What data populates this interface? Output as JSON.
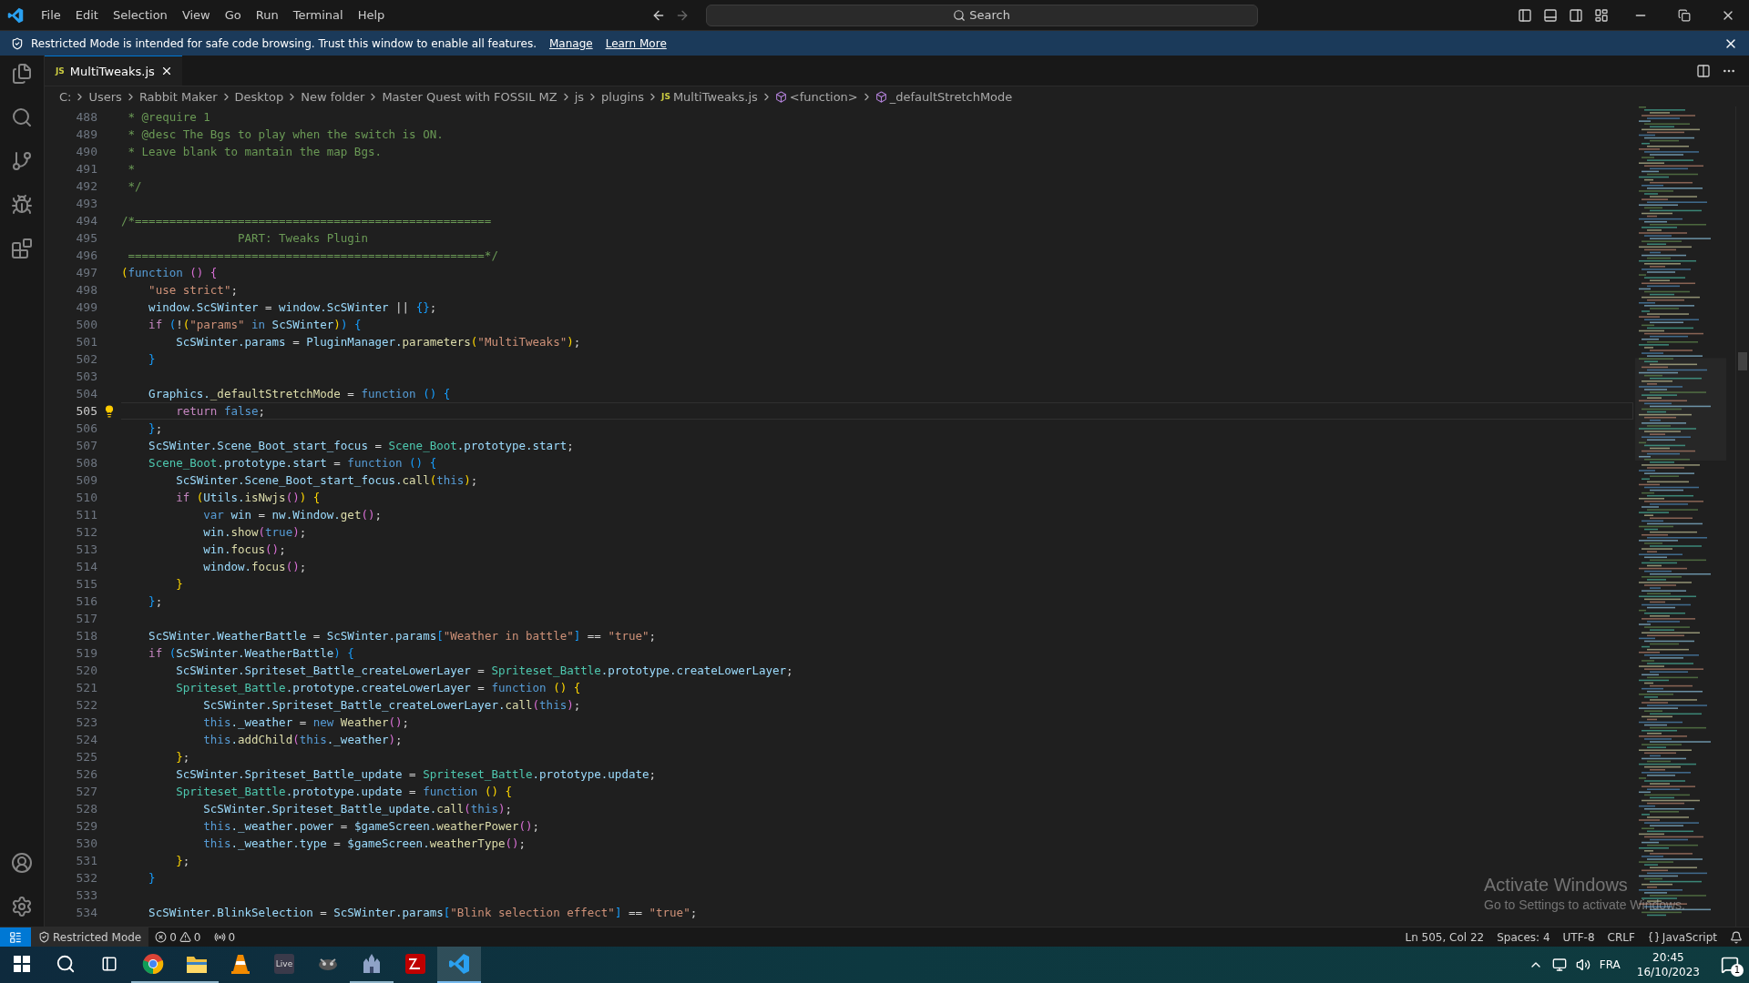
{
  "title_bar": {
    "menu": [
      "File",
      "Edit",
      "Selection",
      "View",
      "Go",
      "Run",
      "Terminal",
      "Help"
    ],
    "search": {
      "placeholder": "Search"
    }
  },
  "banner": {
    "message": "Restricted Mode is intended for safe code browsing. Trust this window to enable all features.",
    "links": [
      "Manage",
      "Learn More"
    ]
  },
  "tabs": [
    {
      "label": "MultiTweaks.js",
      "badge": "JS",
      "selected": true
    }
  ],
  "breadcrumbs": [
    {
      "label": "C:",
      "kind": "folder"
    },
    {
      "label": "Users",
      "kind": "folder"
    },
    {
      "label": "Rabbit Maker",
      "kind": "folder"
    },
    {
      "label": "Desktop",
      "kind": "folder"
    },
    {
      "label": "New folder",
      "kind": "folder"
    },
    {
      "label": "Master Quest with FOSSIL MZ",
      "kind": "folder"
    },
    {
      "label": "js",
      "kind": "folder"
    },
    {
      "label": "plugins",
      "kind": "folder"
    },
    {
      "label": "MultiTweaks.js",
      "kind": "file",
      "badge": "JS"
    },
    {
      "label": "<function>",
      "kind": "symbol"
    },
    {
      "label": "_defaultStretchMode",
      "kind": "symbol"
    }
  ],
  "editor": {
    "lines": [
      {
        "number": "488",
        "current": false,
        "tokens": [
          {
            "kind": "comment",
            "text": " * @require 1"
          }
        ]
      },
      {
        "number": "489",
        "current": false,
        "tokens": [
          {
            "kind": "comment",
            "text": " * @desc The Bgs to play when the switch is ON."
          }
        ]
      },
      {
        "number": "490",
        "current": false,
        "tokens": [
          {
            "kind": "comment",
            "text": " * Leave blank to mantain the map Bgs."
          }
        ]
      },
      {
        "number": "491",
        "current": false,
        "tokens": [
          {
            "kind": "comment",
            "text": " *"
          }
        ]
      },
      {
        "number": "492",
        "current": false,
        "tokens": [
          {
            "kind": "comment",
            "text": " */"
          }
        ]
      },
      {
        "number": "493",
        "current": false
      },
      {
        "number": "494",
        "current": false,
        "tokens": [
          {
            "kind": "comment",
            "text": "/*===================================================="
          }
        ]
      },
      {
        "number": "495",
        "current": false,
        "tokens": [
          {
            "kind": "comment",
            "text": "                 PART: Tweaks Plugin"
          }
        ]
      },
      {
        "number": "496",
        "current": false,
        "tokens": [
          {
            "kind": "comment",
            "text": " ====================================================*/"
          }
        ]
      },
      {
        "number": "497",
        "current": false,
        "tokens": [
          {
            "kind": "bracket1",
            "text": "("
          },
          {
            "kind": "keyword",
            "text": "function "
          },
          {
            "kind": "bracket2",
            "text": "() {"
          }
        ]
      },
      {
        "number": "498",
        "current": false,
        "tokens": [
          {
            "kind": "string",
            "text": "    \"use strict\""
          },
          {
            "kind": "plain",
            "text": ";"
          }
        ]
      },
      {
        "number": "499",
        "current": false,
        "tokens": [
          {
            "kind": "variable",
            "text": "    window.ScSWinter"
          },
          {
            "kind": "plain",
            "text": " = "
          },
          {
            "kind": "variable",
            "text": "window.ScSWinter"
          },
          {
            "kind": "plain",
            "text": " || "
          },
          {
            "kind": "bracket3",
            "text": "{}"
          },
          {
            "kind": "plain",
            "text": ";"
          }
        ]
      },
      {
        "number": "500",
        "current": false,
        "tokens": [
          {
            "kind": "control",
            "text": "    if "
          },
          {
            "kind": "bracket3",
            "text": "("
          },
          {
            "kind": "plain",
            "text": "!"
          },
          {
            "kind": "bracket1",
            "text": "("
          },
          {
            "kind": "string",
            "text": "\"params\" "
          },
          {
            "kind": "keyword",
            "text": "in"
          },
          {
            "kind": "variable",
            "text": " ScSWinter"
          },
          {
            "kind": "bracket1",
            "text": ")"
          },
          {
            "kind": "bracket3",
            "text": ") {"
          }
        ]
      },
      {
        "number": "501",
        "current": false,
        "tokens": [
          {
            "kind": "variable",
            "text": "        ScSWinter.params"
          },
          {
            "kind": "plain",
            "text": " = "
          },
          {
            "kind": "variable",
            "text": "PluginManager."
          },
          {
            "kind": "function",
            "text": "parameters"
          },
          {
            "kind": "bracket1",
            "text": "("
          },
          {
            "kind": "string",
            "text": "\"MultiTweaks\""
          },
          {
            "kind": "bracket1",
            "text": ")"
          },
          {
            "kind": "plain",
            "text": ";"
          }
        ]
      },
      {
        "number": "502",
        "current": false,
        "tokens": [
          {
            "kind": "bracket3",
            "text": "    }"
          }
        ]
      },
      {
        "number": "503",
        "current": false
      },
      {
        "number": "504",
        "current": false,
        "tokens": [
          {
            "kind": "variable",
            "text": "    Graphics."
          },
          {
            "kind": "function",
            "text": "_defaultStretchMode"
          },
          {
            "kind": "plain",
            "text": " = "
          },
          {
            "kind": "keyword",
            "text": "function "
          },
          {
            "kind": "bracket3",
            "text": "() {"
          }
        ]
      },
      {
        "number": "505",
        "current": true,
        "tokens": [
          {
            "kind": "control",
            "text": "        return "
          },
          {
            "kind": "keyword",
            "text": "false"
          },
          {
            "kind": "plain",
            "text": ";"
          }
        ]
      },
      {
        "number": "506",
        "current": false,
        "tokens": [
          {
            "kind": "bracket3",
            "text": "    }"
          },
          {
            "kind": "plain",
            "text": ";"
          }
        ]
      },
      {
        "number": "507",
        "current": false,
        "tokens": [
          {
            "kind": "variable",
            "text": "    ScSWinter.Scene_Boot_start_focus"
          },
          {
            "kind": "plain",
            "text": " = "
          },
          {
            "kind": "class",
            "text": "Scene_Boot"
          },
          {
            "kind": "variable",
            "text": ".prototype.start"
          },
          {
            "kind": "plain",
            "text": ";"
          }
        ]
      },
      {
        "number": "508",
        "current": false,
        "tokens": [
          {
            "kind": "class",
            "text": "    Scene_Boot"
          },
          {
            "kind": "variable",
            "text": ".prototype.start"
          },
          {
            "kind": "plain",
            "text": " = "
          },
          {
            "kind": "keyword",
            "text": "function "
          },
          {
            "kind": "bracket3",
            "text": "() {"
          }
        ]
      },
      {
        "number": "509",
        "current": false,
        "tokens": [
          {
            "kind": "variable",
            "text": "        ScSWinter.Scene_Boot_start_focus."
          },
          {
            "kind": "function",
            "text": "call"
          },
          {
            "kind": "bracket1",
            "text": "("
          },
          {
            "kind": "keyword",
            "text": "this"
          },
          {
            "kind": "bracket1",
            "text": ")"
          },
          {
            "kind": "plain",
            "text": ";"
          }
        ]
      },
      {
        "number": "510",
        "current": false,
        "tokens": [
          {
            "kind": "control",
            "text": "        if "
          },
          {
            "kind": "bracket1",
            "text": "("
          },
          {
            "kind": "variable",
            "text": "Utils."
          },
          {
            "kind": "function",
            "text": "isNwjs"
          },
          {
            "kind": "bracket2",
            "text": "()"
          },
          {
            "kind": "bracket1",
            "text": ") {"
          }
        ]
      },
      {
        "number": "511",
        "current": false,
        "tokens": [
          {
            "kind": "keyword",
            "text": "            var"
          },
          {
            "kind": "variable",
            "text": " win"
          },
          {
            "kind": "plain",
            "text": " = "
          },
          {
            "kind": "variable",
            "text": "nw.Window."
          },
          {
            "kind": "function",
            "text": "get"
          },
          {
            "kind": "bracket2",
            "text": "()"
          },
          {
            "kind": "plain",
            "text": ";"
          }
        ]
      },
      {
        "number": "512",
        "current": false,
        "tokens": [
          {
            "kind": "variable",
            "text": "            win."
          },
          {
            "kind": "function",
            "text": "show"
          },
          {
            "kind": "bracket2",
            "text": "("
          },
          {
            "kind": "keyword",
            "text": "true"
          },
          {
            "kind": "bracket2",
            "text": ")"
          },
          {
            "kind": "plain",
            "text": ";"
          }
        ]
      },
      {
        "number": "513",
        "current": false,
        "tokens": [
          {
            "kind": "variable",
            "text": "            win."
          },
          {
            "kind": "function",
            "text": "focus"
          },
          {
            "kind": "bracket2",
            "text": "()"
          },
          {
            "kind": "plain",
            "text": ";"
          }
        ]
      },
      {
        "number": "514",
        "current": false,
        "tokens": [
          {
            "kind": "variable",
            "text": "            window."
          },
          {
            "kind": "function",
            "text": "focus"
          },
          {
            "kind": "bracket2",
            "text": "()"
          },
          {
            "kind": "plain",
            "text": ";"
          }
        ]
      },
      {
        "number": "515",
        "current": false,
        "tokens": [
          {
            "kind": "bracket1",
            "text": "        }"
          }
        ]
      },
      {
        "number": "516",
        "current": false,
        "tokens": [
          {
            "kind": "bracket3",
            "text": "    }"
          },
          {
            "kind": "plain",
            "text": ";"
          }
        ]
      },
      {
        "number": "517",
        "current": false
      },
      {
        "number": "518",
        "current": false,
        "tokens": [
          {
            "kind": "variable",
            "text": "    ScSWinter.WeatherBattle"
          },
          {
            "kind": "plain",
            "text": " = "
          },
          {
            "kind": "variable",
            "text": "ScSWinter.params"
          },
          {
            "kind": "bracket3",
            "text": "["
          },
          {
            "kind": "string",
            "text": "\"Weather in battle\""
          },
          {
            "kind": "bracket3",
            "text": "]"
          },
          {
            "kind": "plain",
            "text": " == "
          },
          {
            "kind": "string",
            "text": "\"true\""
          },
          {
            "kind": "plain",
            "text": ";"
          }
        ]
      },
      {
        "number": "519",
        "current": false,
        "tokens": [
          {
            "kind": "control",
            "text": "    if "
          },
          {
            "kind": "bracket3",
            "text": "("
          },
          {
            "kind": "variable",
            "text": "ScSWinter.WeatherBattle"
          },
          {
            "kind": "bracket3",
            "text": ") {"
          }
        ]
      },
      {
        "number": "520",
        "current": false,
        "tokens": [
          {
            "kind": "variable",
            "text": "        ScSWinter.Spriteset_Battle_createLowerLayer"
          },
          {
            "kind": "plain",
            "text": " = "
          },
          {
            "kind": "class",
            "text": "Spriteset_Battle"
          },
          {
            "kind": "variable",
            "text": ".prototype.createLowerLayer"
          },
          {
            "kind": "plain",
            "text": ";"
          }
        ]
      },
      {
        "number": "521",
        "current": false,
        "tokens": [
          {
            "kind": "class",
            "text": "        Spriteset_Battle"
          },
          {
            "kind": "variable",
            "text": ".prototype.createLowerLayer"
          },
          {
            "kind": "plain",
            "text": " = "
          },
          {
            "kind": "keyword",
            "text": "function "
          },
          {
            "kind": "bracket1",
            "text": "() {"
          }
        ]
      },
      {
        "number": "522",
        "current": false,
        "tokens": [
          {
            "kind": "variable",
            "text": "            ScSWinter.Spriteset_Battle_createLowerLayer."
          },
          {
            "kind": "function",
            "text": "call"
          },
          {
            "kind": "bracket2",
            "text": "("
          },
          {
            "kind": "keyword",
            "text": "this"
          },
          {
            "kind": "bracket2",
            "text": ")"
          },
          {
            "kind": "plain",
            "text": ";"
          }
        ]
      },
      {
        "number": "523",
        "current": false,
        "tokens": [
          {
            "kind": "keyword",
            "text": "            this"
          },
          {
            "kind": "variable",
            "text": "._weather"
          },
          {
            "kind": "plain",
            "text": " = "
          },
          {
            "kind": "keyword",
            "text": "new "
          },
          {
            "kind": "function",
            "text": "Weather"
          },
          {
            "kind": "bracket2",
            "text": "()"
          },
          {
            "kind": "plain",
            "text": ";"
          }
        ]
      },
      {
        "number": "524",
        "current": false,
        "tokens": [
          {
            "kind": "keyword",
            "text": "            this"
          },
          {
            "kind": "variable",
            "text": "."
          },
          {
            "kind": "function",
            "text": "addChild"
          },
          {
            "kind": "bracket2",
            "text": "("
          },
          {
            "kind": "keyword",
            "text": "this"
          },
          {
            "kind": "variable",
            "text": "._weather"
          },
          {
            "kind": "bracket2",
            "text": ")"
          },
          {
            "kind": "plain",
            "text": ";"
          }
        ]
      },
      {
        "number": "525",
        "current": false,
        "tokens": [
          {
            "kind": "bracket1",
            "text": "        }"
          },
          {
            "kind": "plain",
            "text": ";"
          }
        ]
      },
      {
        "number": "526",
        "current": false,
        "tokens": [
          {
            "kind": "variable",
            "text": "        ScSWinter.Spriteset_Battle_update"
          },
          {
            "kind": "plain",
            "text": " = "
          },
          {
            "kind": "class",
            "text": "Spriteset_Battle"
          },
          {
            "kind": "variable",
            "text": ".prototype.update"
          },
          {
            "kind": "plain",
            "text": ";"
          }
        ]
      },
      {
        "number": "527",
        "current": false,
        "tokens": [
          {
            "kind": "class",
            "text": "        Spriteset_Battle"
          },
          {
            "kind": "variable",
            "text": ".prototype.update"
          },
          {
            "kind": "plain",
            "text": " = "
          },
          {
            "kind": "keyword",
            "text": "function "
          },
          {
            "kind": "bracket1",
            "text": "() {"
          }
        ]
      },
      {
        "number": "528",
        "current": false,
        "tokens": [
          {
            "kind": "variable",
            "text": "            ScSWinter.Spriteset_Battle_update."
          },
          {
            "kind": "function",
            "text": "call"
          },
          {
            "kind": "bracket2",
            "text": "("
          },
          {
            "kind": "keyword",
            "text": "this"
          },
          {
            "kind": "bracket2",
            "text": ")"
          },
          {
            "kind": "plain",
            "text": ";"
          }
        ]
      },
      {
        "number": "529",
        "current": false,
        "tokens": [
          {
            "kind": "keyword",
            "text": "            this"
          },
          {
            "kind": "variable",
            "text": "._weather.power"
          },
          {
            "kind": "plain",
            "text": " = "
          },
          {
            "kind": "variable",
            "text": "$gameScreen."
          },
          {
            "kind": "function",
            "text": "weatherPower"
          },
          {
            "kind": "bracket2",
            "text": "()"
          },
          {
            "kind": "plain",
            "text": ";"
          }
        ]
      },
      {
        "number": "530",
        "current": false,
        "tokens": [
          {
            "kind": "keyword",
            "text": "            this"
          },
          {
            "kind": "variable",
            "text": "._weather.type"
          },
          {
            "kind": "plain",
            "text": " = "
          },
          {
            "kind": "variable",
            "text": "$gameScreen."
          },
          {
            "kind": "function",
            "text": "weatherType"
          },
          {
            "kind": "bracket2",
            "text": "()"
          },
          {
            "kind": "plain",
            "text": ";"
          }
        ]
      },
      {
        "number": "531",
        "current": false,
        "tokens": [
          {
            "kind": "bracket1",
            "text": "        }"
          },
          {
            "kind": "plain",
            "text": ";"
          }
        ]
      },
      {
        "number": "532",
        "current": false,
        "tokens": [
          {
            "kind": "bracket3",
            "text": "    }"
          }
        ]
      },
      {
        "number": "533",
        "current": false
      },
      {
        "number": "534",
        "current": false,
        "tokens": [
          {
            "kind": "variable",
            "text": "    ScSWinter.BlinkSelection"
          },
          {
            "kind": "plain",
            "text": " = "
          },
          {
            "kind": "variable",
            "text": "ScSWinter.params"
          },
          {
            "kind": "bracket3",
            "text": "["
          },
          {
            "kind": "string",
            "text": "\"Blink selection effect\""
          },
          {
            "kind": "bracket3",
            "text": "]"
          },
          {
            "kind": "plain",
            "text": " == "
          },
          {
            "kind": "string",
            "text": "\"true\""
          },
          {
            "kind": "plain",
            "text": ";"
          }
        ]
      }
    ]
  },
  "activation_notice": {
    "title": "Activate Windows",
    "subtitle": "Go to Settings to activate Windows."
  },
  "status_bar": {
    "restricted": "Restricted Mode",
    "errors": "0",
    "warnings": "0",
    "ports": "0",
    "items": [
      "Ln 505, Col 22",
      "Spaces: 4",
      "UTF-8",
      "CRLF"
    ],
    "language": "JavaScript"
  },
  "taskbar": {
    "apps": [
      {
        "kind": "chrome",
        "open": true,
        "selected": false
      },
      {
        "kind": "explorer",
        "open": true,
        "selected": false
      },
      {
        "kind": "vlc",
        "open": false,
        "selected": false
      },
      {
        "kind": "live",
        "label": "Live",
        "open": false,
        "selected": false
      },
      {
        "kind": "game",
        "open": false,
        "selected": false
      },
      {
        "kind": "castle",
        "open": true,
        "selected": false
      },
      {
        "kind": "filezilla",
        "open": false,
        "selected": false
      },
      {
        "kind": "vscode",
        "open": true,
        "selected": true
      }
    ],
    "language": "FRA",
    "time": "20:45",
    "date": "16/10/2023",
    "notifications": "1"
  }
}
